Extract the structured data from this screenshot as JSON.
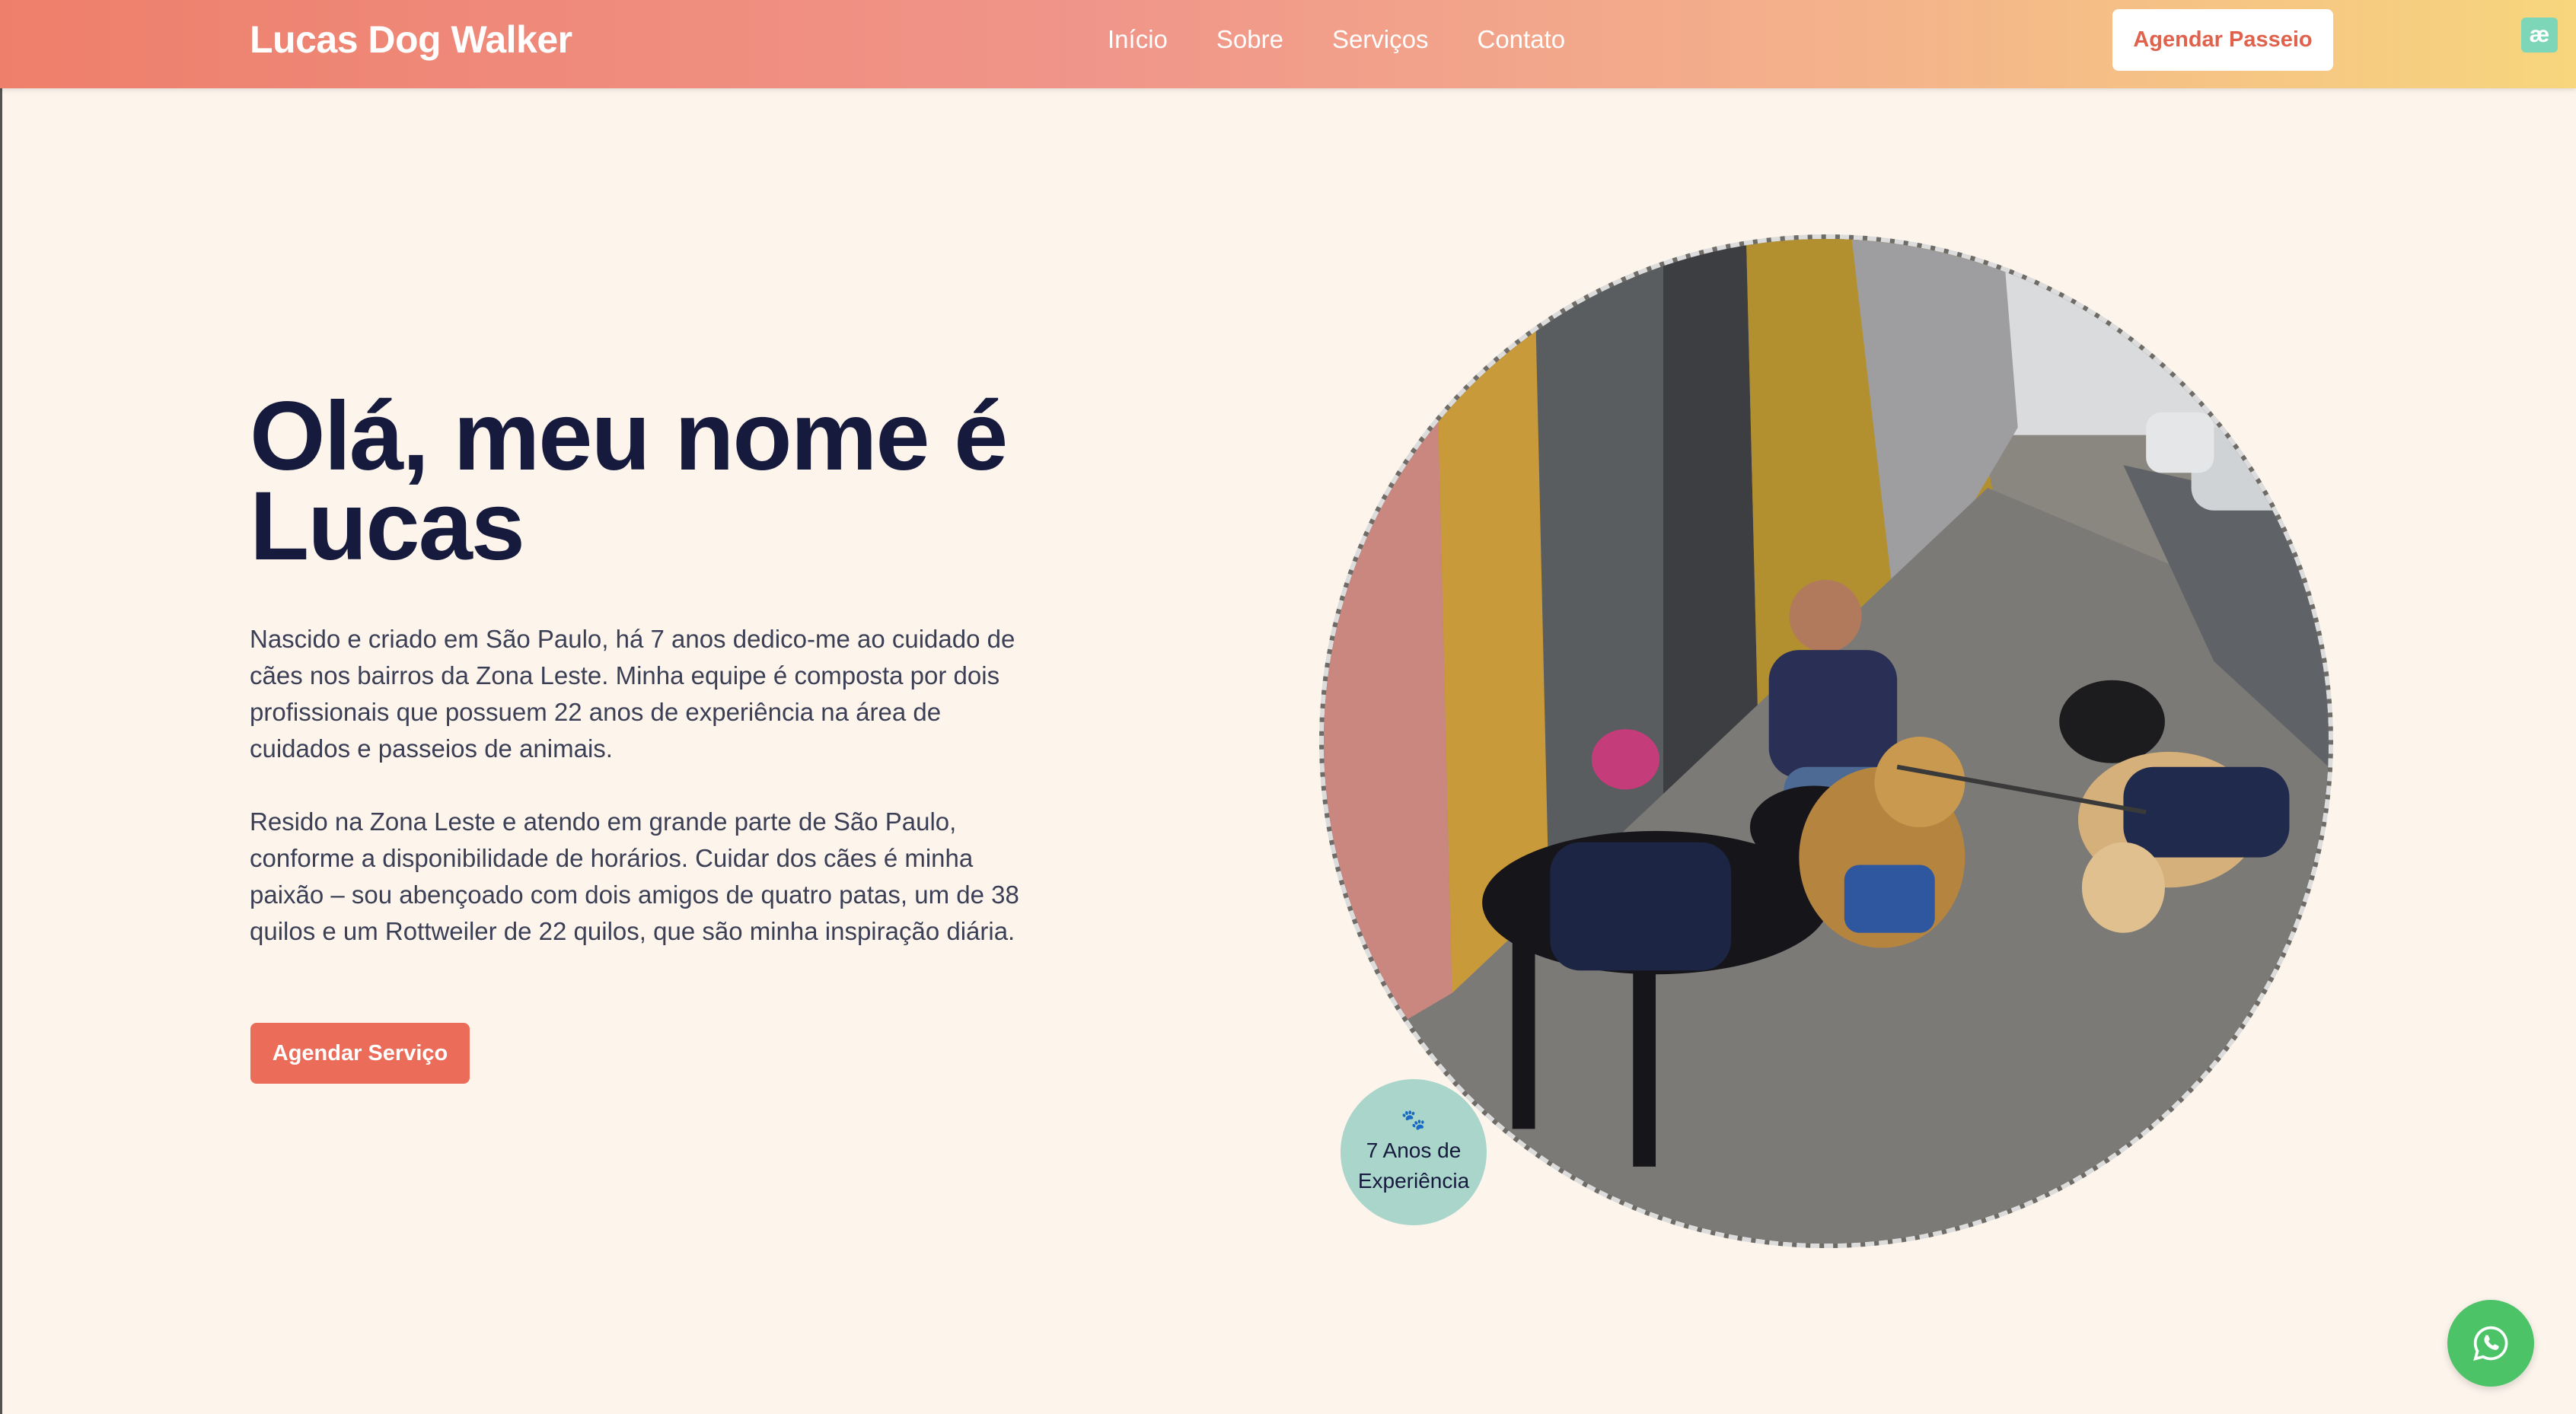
{
  "header": {
    "brand": "Lucas Dog Walker",
    "nav": [
      "Início",
      "Sobre",
      "Serviços",
      "Contato"
    ],
    "cta": "Agendar Passeio",
    "extension_badge": "æ"
  },
  "hero": {
    "title": "Olá, meu nome é Lucas",
    "paragraph_1": "Nascido e criado em São Paulo, há 7 anos dedico-me ao cuidado de cães nos bairros da Zona Leste. Minha equipe é composta por dois profissionais que possuem 22 anos de experiência na área de cuidados e passeios de animais.",
    "paragraph_2": "Resido na Zona Leste e atendo em grande parte de São Paulo, conforme a disponibilidade de horários. Cuidar dos cães é minha paixão – sou abençoado com dois amigos de quatro patas, um de 38 quilos e um Rottweiler de 22 quilos, que são minha inspiração diária.",
    "cta": "Agendar Serviço"
  },
  "photo": {
    "icon": "dog-walker-photo"
  },
  "experience_badge": {
    "icon": "paw-icon",
    "paw_glyph": "🐾",
    "text": "7 Anos de Experiência"
  },
  "whatsapp": {
    "icon": "whatsapp-icon"
  },
  "colors": {
    "header_gradient_start": "#ee7f6b",
    "header_gradient_end": "#f7d67d",
    "background": "#fdf5ec",
    "heading": "#161a3d",
    "accent": "#eb6d59",
    "badge": "#a9d5cb",
    "whatsapp": "#4dc368"
  }
}
